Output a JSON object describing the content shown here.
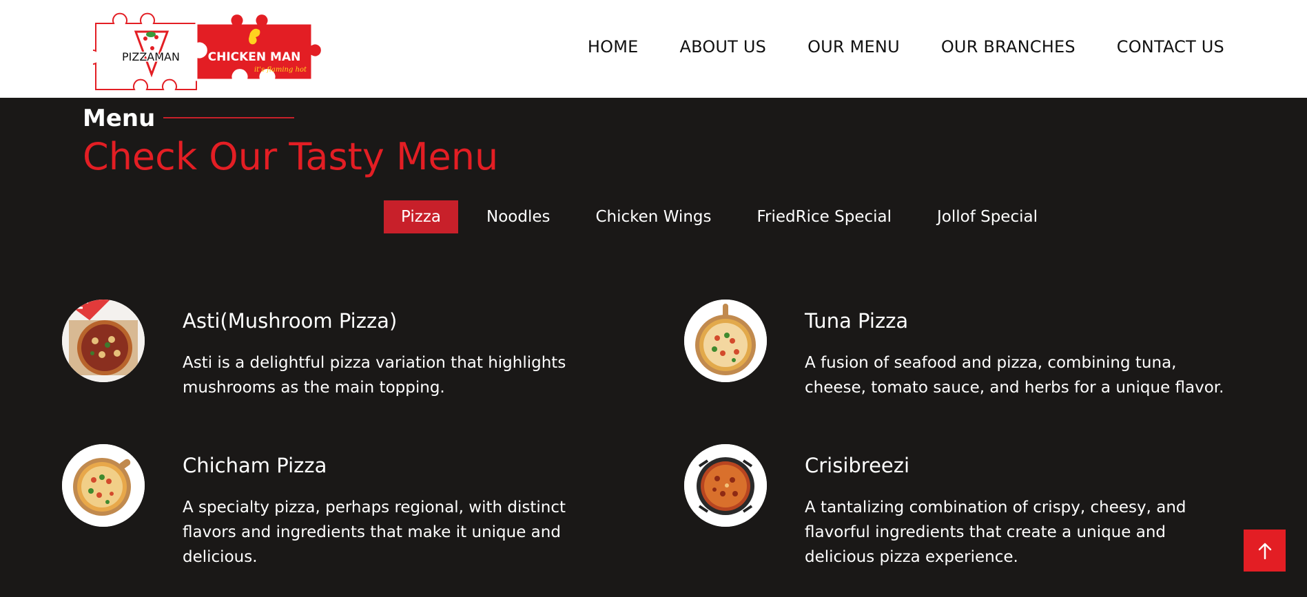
{
  "brand": {
    "logo1_text": "PIZZAMAN",
    "logo2_text": "CHICKEN MAN",
    "logo2_tagline": "it's flaming hot",
    "colors": {
      "red": "#e31e24",
      "dark_red": "#c8202a",
      "background": "#1a1817",
      "yellow": "#ffd21f"
    }
  },
  "nav": {
    "items": [
      "HOME",
      "ABOUT US",
      "OUR MENU",
      "OUR BRANCHES",
      "CONTACT US"
    ]
  },
  "section": {
    "subtitle": "Menu",
    "title": "Check Our Tasty Menu"
  },
  "tabs": {
    "items": [
      "Pizza",
      "Noodles",
      "Chicken Wings",
      "FriedRice Special",
      "Jollof Special"
    ],
    "active": "Pizza"
  },
  "menu_items": [
    {
      "name": "Asti(Mushroom Pizza)",
      "description": "Asti is a delightful pizza variation that highlights mushrooms as the main topping."
    },
    {
      "name": "Tuna Pizza",
      "description": "A fusion of seafood and pizza, combining tuna, cheese, tomato sauce, and herbs for a unique flavor."
    },
    {
      "name": "Chicham Pizza",
      "description": "A specialty pizza, perhaps regional, with distinct flavors and ingredients that make it unique and delicious."
    },
    {
      "name": "Crisibreezi",
      "description": "A tantalizing combination of crispy, cheesy, and flavorful ingredients that create a unique and delicious pizza experience."
    }
  ],
  "icons": {
    "scroll_top": "arrow-up-icon"
  }
}
